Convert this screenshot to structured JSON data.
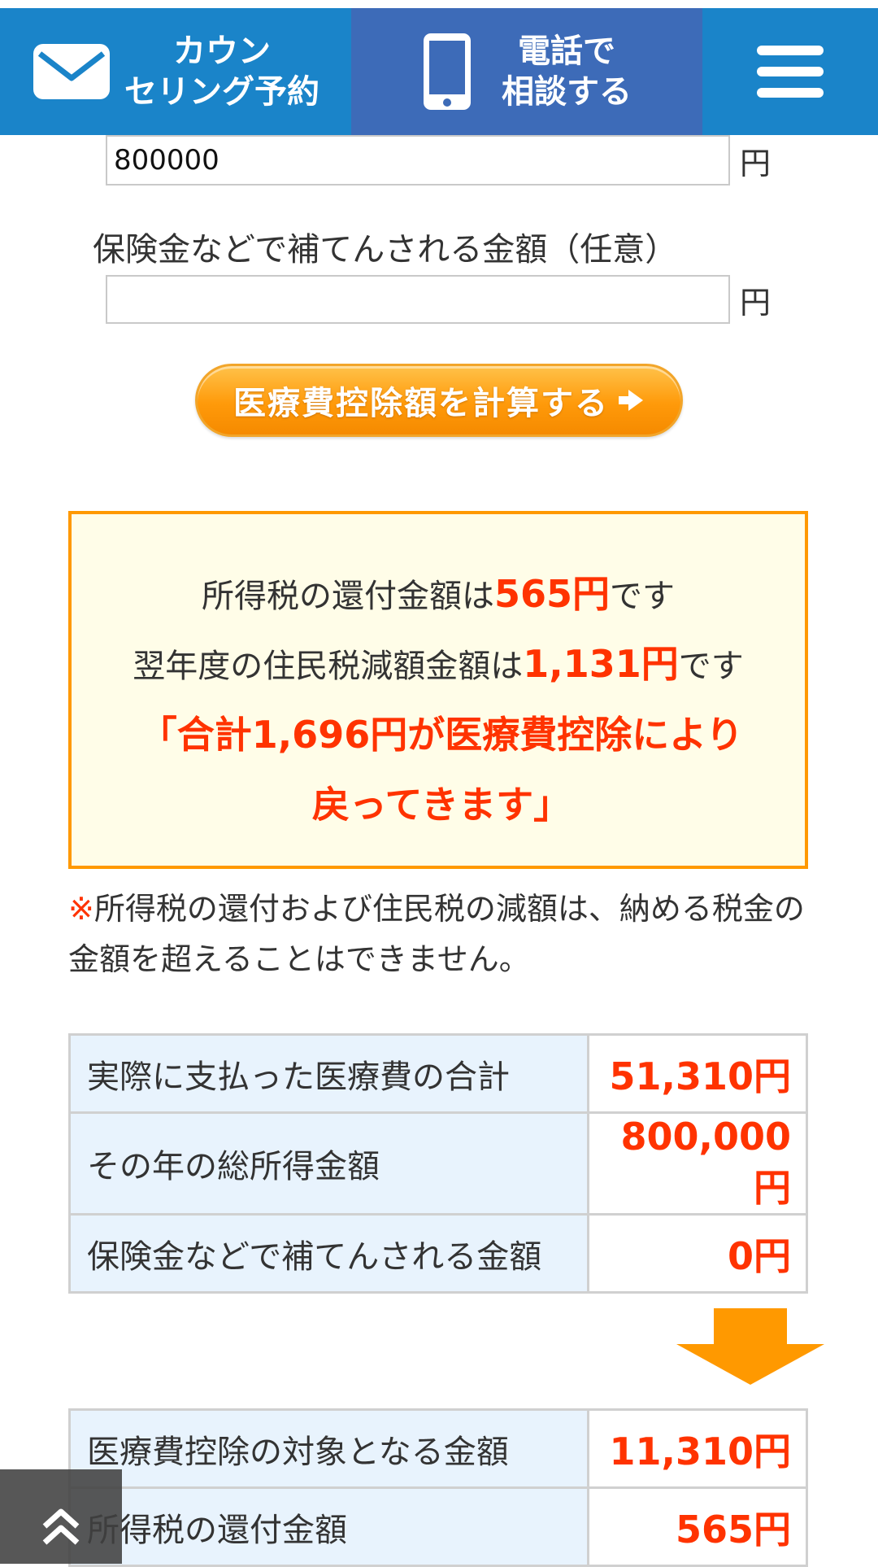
{
  "header": {
    "counsel_label": "カウン\nセリング予約",
    "phone_label": "電話で\n相談する",
    "brand_color": "#1a84c9",
    "phone_color": "#3d6bb8",
    "icons": [
      "mail-icon",
      "smartphone-icon",
      "hamburger-menu-icon"
    ]
  },
  "form": {
    "income_value": "800000",
    "unit": "円",
    "insurance_label": "保険金などで補てんされる金額（任意）",
    "insurance_value": "",
    "calc_button_label": "医療費控除額を計算する"
  },
  "result": {
    "line1_prefix": "所得税の還付金額は",
    "line1_amount": "565円",
    "line1_suffix": "です",
    "line2_prefix": "翌年度の住民税減額金額は",
    "line2_amount": "1,131円",
    "line2_suffix": "です",
    "total_text": "「合計1,696円が医療費控除により戻ってきます」",
    "accent_color": "#ff3300",
    "border_color": "#ff9900"
  },
  "note": {
    "mark": "※",
    "text": "所得税の還付および住民税の減額は、納める税金の金額を超えることはできません。"
  },
  "summary_table": [
    {
      "label": "実際に支払った医療費の合計",
      "value": "51,310円"
    },
    {
      "label": "その年の総所得金額",
      "value": "800,000円"
    },
    {
      "label": "保険金などで補てんされる金額",
      "value": "0円"
    }
  ],
  "result_table": [
    {
      "label": "医療費控除の対象となる金額",
      "value": "11,310円"
    },
    {
      "label": "所得税の還付金額",
      "value": "565円"
    }
  ],
  "icons": {
    "calc_button_icon": "arrow-right-icon",
    "down_arrow": "down-arrow-icon",
    "back_to_top": "double-chevron-up-icon"
  }
}
